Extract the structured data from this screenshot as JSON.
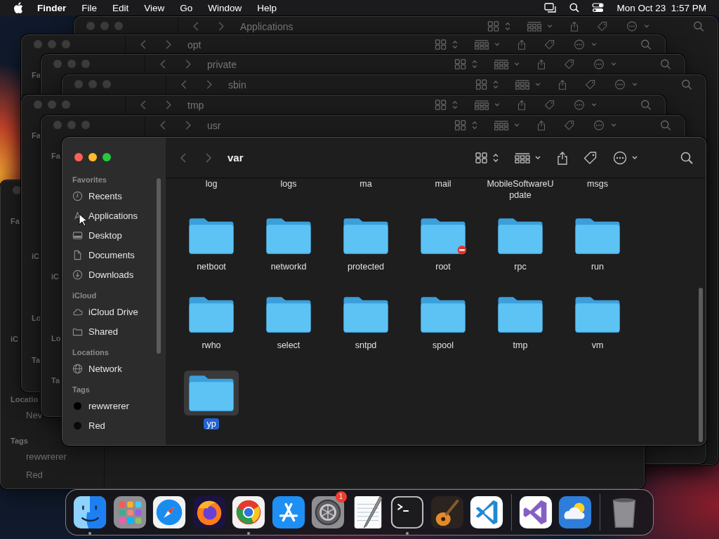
{
  "menu_bar": {
    "app_name": "Finder",
    "menus": [
      "File",
      "Edit",
      "View",
      "Go",
      "Window",
      "Help"
    ],
    "clock": "Mon Oct 23  1:57 PM"
  },
  "background_windows": [
    {
      "title": "Applications"
    },
    {
      "title": "opt",
      "sidebar": {
        "favorites": {
          "heading": "Fa"
        }
      }
    },
    {
      "title": "private"
    },
    {
      "title": "sbin"
    },
    {
      "sidebar": {
        "favorites": {
          "heading": "Fa"
        },
        "icloud": {
          "heading": "iC"
        },
        "locations": {
          "heading": "Locatio",
          "items": [
            "Nev"
          ]
        },
        "tags": {
          "heading": "Tags",
          "items": [
            "rewwrerer",
            "Red"
          ]
        }
      }
    },
    {
      "title": "tmp",
      "sidebar": {
        "favorites": {
          "heading": "Fa"
        },
        "icloud": {
          "heading": "iC"
        },
        "locations": {
          "heading": "Lo"
        },
        "tags": {
          "heading": "Ta"
        }
      }
    },
    {
      "title": "usr",
      "sidebar": {
        "favorites": {
          "heading": "Fa"
        },
        "icloud": {
          "heading": "iC"
        },
        "locations": {
          "heading": "Lo"
        },
        "tags": {
          "heading": "Ta"
        }
      }
    }
  ],
  "window": {
    "title": "var",
    "sidebar": {
      "favorites": {
        "heading": "Favorites",
        "items": [
          {
            "label": "Recents"
          },
          {
            "label": "Applications"
          },
          {
            "label": "Desktop"
          },
          {
            "label": "Documents"
          },
          {
            "label": "Downloads"
          }
        ]
      },
      "icloud": {
        "heading": "iCloud",
        "items": [
          {
            "label": "iCloud Drive"
          },
          {
            "label": "Shared"
          }
        ]
      },
      "locations": {
        "heading": "Locations",
        "items": [
          {
            "label": "Network"
          }
        ]
      },
      "tags": {
        "heading": "Tags",
        "items": [
          {
            "label": "rewwrerer",
            "color": "#000000"
          },
          {
            "label": "Red",
            "color": "#0a0a0a"
          }
        ]
      }
    },
    "files": [
      {
        "name": "log",
        "kind": "label",
        "selected": false
      },
      {
        "name": "logs",
        "kind": "label",
        "selected": false
      },
      {
        "name": "ma",
        "kind": "label",
        "selected": false
      },
      {
        "name": "mail",
        "kind": "label",
        "selected": false
      },
      {
        "name": "MobileSoftwareUpdate",
        "kind": "label",
        "selected": false
      },
      {
        "name": "msgs",
        "kind": "label",
        "selected": false
      },
      {
        "name": "netboot",
        "kind": "folder",
        "locked": false,
        "selected": false
      },
      {
        "name": "networkd",
        "kind": "folder",
        "locked": false,
        "selected": false
      },
      {
        "name": "protected",
        "kind": "folder",
        "locked": false,
        "selected": false
      },
      {
        "name": "root",
        "kind": "folder",
        "locked": true,
        "selected": false
      },
      {
        "name": "rpc",
        "kind": "folder",
        "locked": false,
        "selected": false
      },
      {
        "name": "run",
        "kind": "folder",
        "locked": false,
        "selected": false
      },
      {
        "name": "rwho",
        "kind": "folder",
        "locked": false,
        "selected": false
      },
      {
        "name": "select",
        "kind": "folder",
        "locked": false,
        "selected": false
      },
      {
        "name": "sntpd",
        "kind": "folder",
        "locked": false,
        "selected": false
      },
      {
        "name": "spool",
        "kind": "folder",
        "locked": false,
        "selected": false
      },
      {
        "name": "tmp",
        "kind": "folder",
        "locked": false,
        "selected": false
      },
      {
        "name": "vm",
        "kind": "folder",
        "locked": false,
        "selected": false
      },
      {
        "name": "yp",
        "kind": "folder",
        "locked": false,
        "selected": true
      }
    ]
  },
  "dock": {
    "sections": [
      [
        {
          "running": true
        },
        {
          "running": false
        },
        {
          "running": false
        },
        {
          "running": false
        },
        {
          "running": true
        },
        {
          "running": false
        },
        {
          "running": false,
          "badge": "1"
        },
        {
          "running": false
        },
        {
          "running": true
        },
        {
          "running": false
        },
        {
          "running": false
        }
      ],
      [
        {
          "running": false
        },
        {
          "running": false
        }
      ],
      [
        {
          "running": false
        }
      ]
    ]
  }
}
